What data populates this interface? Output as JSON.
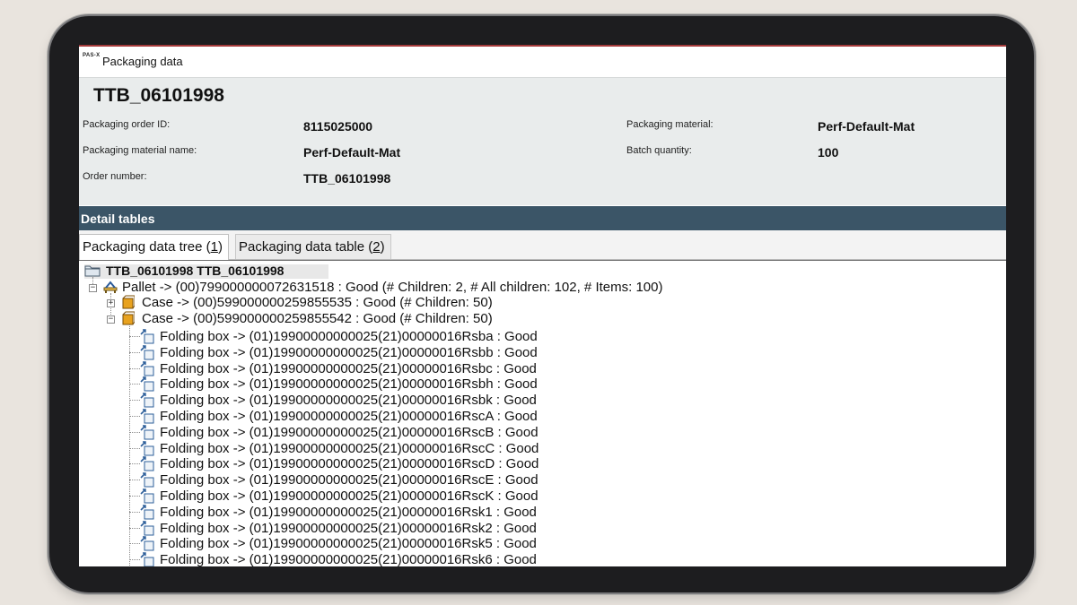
{
  "window": {
    "logo_text": "PAS-X",
    "title": "Packaging data"
  },
  "header": {
    "order_title": "TTB_06101998",
    "fields": {
      "packaging_order_id": {
        "label": "Packaging order ID:",
        "value": "8115025000"
      },
      "packaging_material": {
        "label": "Packaging material:",
        "value": "Perf-Default-Mat"
      },
      "packaging_material_name": {
        "label": "Packaging material name:",
        "value": "Perf-Default-Mat"
      },
      "batch_quantity": {
        "label": "Batch quantity:",
        "value": "100"
      },
      "order_number": {
        "label": "Order number:",
        "value": "TTB_06101998"
      }
    }
  },
  "detail": {
    "section_title": "Detail tables",
    "tabs": [
      {
        "label": "Packaging data tree (",
        "key": "1",
        "suffix": ")",
        "active": true
      },
      {
        "label": "Packaging data table (",
        "key": "2",
        "suffix": ")",
        "active": false
      }
    ]
  },
  "tree": {
    "root": "TTB_06101998 TTB_06101998",
    "pallet": "Pallet -> (00)799000000072631518 : Good (# Children: 2, # All children: 102, # Items: 100)",
    "cases": [
      {
        "label": "Case -> (00)599000000259855535 : Good (# Children: 50)",
        "expander": "+"
      },
      {
        "label": "Case -> (00)599000000259855542 : Good (# Children: 50)",
        "expander": "−"
      }
    ],
    "folding_boxes": [
      "Folding box -> (01)19900000000025(21)00000016Rsba : Good",
      "Folding box -> (01)19900000000025(21)00000016Rsbb : Good",
      "Folding box -> (01)19900000000025(21)00000016Rsbc : Good",
      "Folding box -> (01)19900000000025(21)00000016Rsbh : Good",
      "Folding box -> (01)19900000000025(21)00000016Rsbk : Good",
      "Folding box -> (01)19900000000025(21)00000016RscA : Good",
      "Folding box -> (01)19900000000025(21)00000016RscB : Good",
      "Folding box -> (01)19900000000025(21)00000016RscC : Good",
      "Folding box -> (01)19900000000025(21)00000016RscD : Good",
      "Folding box -> (01)19900000000025(21)00000016RscE : Good",
      "Folding box -> (01)19900000000025(21)00000016RscK : Good",
      "Folding box -> (01)19900000000025(21)00000016Rsk1 : Good",
      "Folding box -> (01)19900000000025(21)00000016Rsk2 : Good",
      "Folding box -> (01)19900000000025(21)00000016Rsk5 : Good",
      "Folding box -> (01)19900000000025(21)00000016Rsk6 : Good"
    ]
  }
}
